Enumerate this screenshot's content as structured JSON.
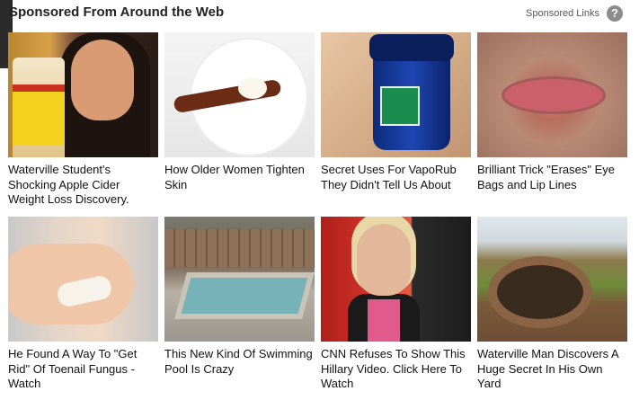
{
  "header": {
    "title": "Sponsored From Around the Web",
    "sponsored_links_label": "Sponsored Links",
    "help_icon": "?"
  },
  "cards": [
    {
      "caption": "Waterville Student's Shocking Apple Cider Weight Loss Discovery.",
      "thumb_icon": "apple-cider-vinegar-photo"
    },
    {
      "caption": "How Older Women Tighten Skin",
      "thumb_icon": "spoon-cream-photo"
    },
    {
      "caption": "Secret Uses For VapoRub They Didn't Tell Us About",
      "thumb_icon": "vaporub-jar-photo"
    },
    {
      "caption": "Brilliant Trick \"Erases\" Eye Bags and Lip Lines",
      "thumb_icon": "wrinkled-lips-photo"
    },
    {
      "caption": "He Found A Way To \"Get Rid\" Of Toenail Fungus - Watch",
      "thumb_icon": "foot-bandage-photo"
    },
    {
      "caption": "This New Kind Of Swimming Pool Is Crazy",
      "thumb_icon": "backyard-pool-photo"
    },
    {
      "caption": "CNN Refuses To Show This Hillary Video. Click Here To Watch",
      "thumb_icon": "hillary-photo"
    },
    {
      "caption": "Waterville Man Discovers A Huge Secret In His Own Yard",
      "thumb_icon": "yard-hole-photo"
    }
  ]
}
